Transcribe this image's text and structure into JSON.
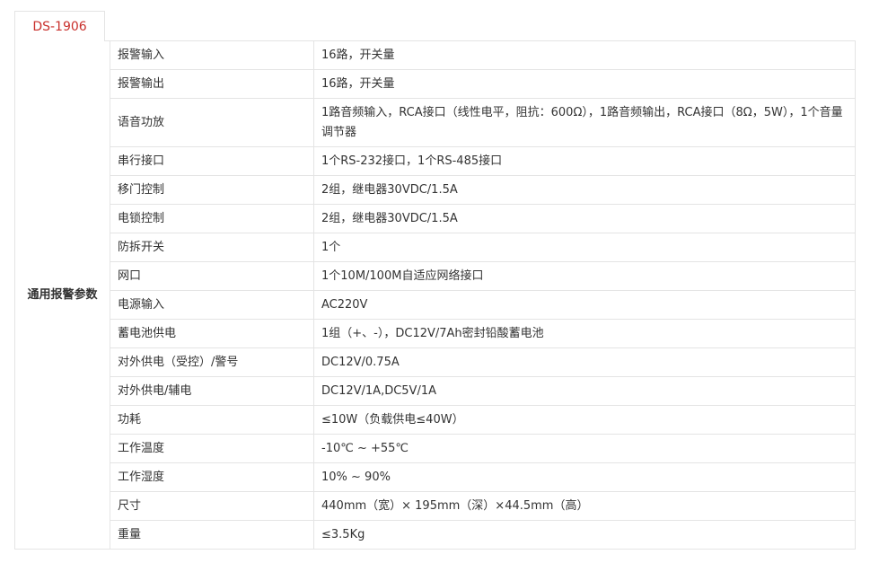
{
  "tab": {
    "label": "DS-1906"
  },
  "table": {
    "group": "通用报警参数",
    "rows": [
      {
        "label": "报警输入",
        "value": "16路，开关量"
      },
      {
        "label": "报警输出",
        "value": "16路，开关量"
      },
      {
        "label": "语音功放",
        "value": "1路音频输入，RCA接口（线性电平，阻抗：600Ω），1路音频输出，RCA接口（8Ω，5W），1个音量调节器"
      },
      {
        "label": "串行接口",
        "value": "1个RS-232接口，1个RS-485接口"
      },
      {
        "label": "移门控制",
        "value": "2组，继电器30VDC/1.5A"
      },
      {
        "label": "电锁控制",
        "value": "2组，继电器30VDC/1.5A"
      },
      {
        "label": "防拆开关",
        "value": "1个"
      },
      {
        "label": "网口",
        "value": "1个10M/100M自适应网络接口"
      },
      {
        "label": "电源输入",
        "value": "AC220V"
      },
      {
        "label": "蓄电池供电",
        "value": "1组（+、-），DC12V/7Ah密封铅酸蓄电池"
      },
      {
        "label": "对外供电（受控）/警号",
        "value": "DC12V/0.75A"
      },
      {
        "label": "对外供电/辅电",
        "value": "DC12V/1A,DC5V/1A"
      },
      {
        "label": "功耗",
        "value": "≤10W（负载供电≤40W）"
      },
      {
        "label": "工作温度",
        "value": "-10℃ ~ +55℃"
      },
      {
        "label": "工作湿度",
        "value": "10% ~ 90%"
      },
      {
        "label": "尺寸",
        "value": "440mm（宽）× 195mm（深）×44.5mm（高）"
      },
      {
        "label": "重量",
        "value": "≤3.5Kg"
      }
    ]
  }
}
